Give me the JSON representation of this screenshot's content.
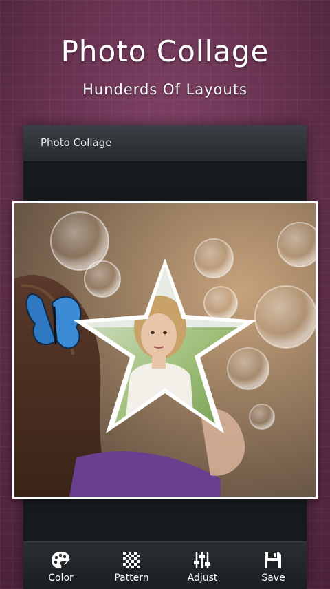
{
  "promo": {
    "title": "Photo Collage",
    "subtitle": "Hunderds Of Layouts"
  },
  "app": {
    "title": "Photo Collage"
  },
  "toolbar": {
    "items": [
      {
        "label": "Color",
        "icon": "palette-icon"
      },
      {
        "label": "Pattern",
        "icon": "checkerboard-icon"
      },
      {
        "label": "Adjust",
        "icon": "sliders-icon"
      },
      {
        "label": "Save",
        "icon": "floppy-disk-icon"
      }
    ]
  },
  "colors": {
    "background": "#6e3656",
    "frame": "#ffffff",
    "toolbar": "#1f2326"
  }
}
